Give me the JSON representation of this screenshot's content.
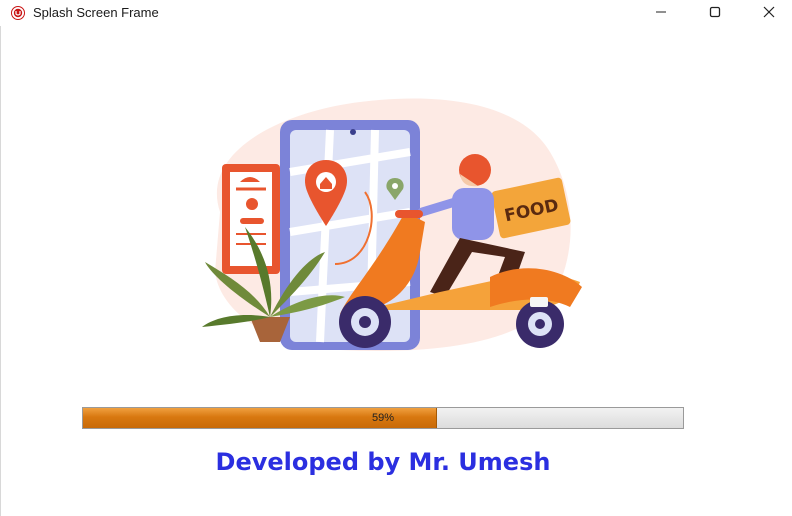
{
  "window": {
    "title": "Splash Screen Frame",
    "app_icon": "java-app-icon",
    "controls": [
      "minimize-icon",
      "maximize-icon",
      "close-icon"
    ]
  },
  "illustration": {
    "icon": "food-delivery-scooter-illustration",
    "sign_text": "FOOD"
  },
  "progress": {
    "value": 0.59,
    "label": "59%",
    "color": "#d87810"
  },
  "footer": {
    "developer_text": "Developed by Mr. Umesh",
    "color": "#2b2fe0"
  }
}
